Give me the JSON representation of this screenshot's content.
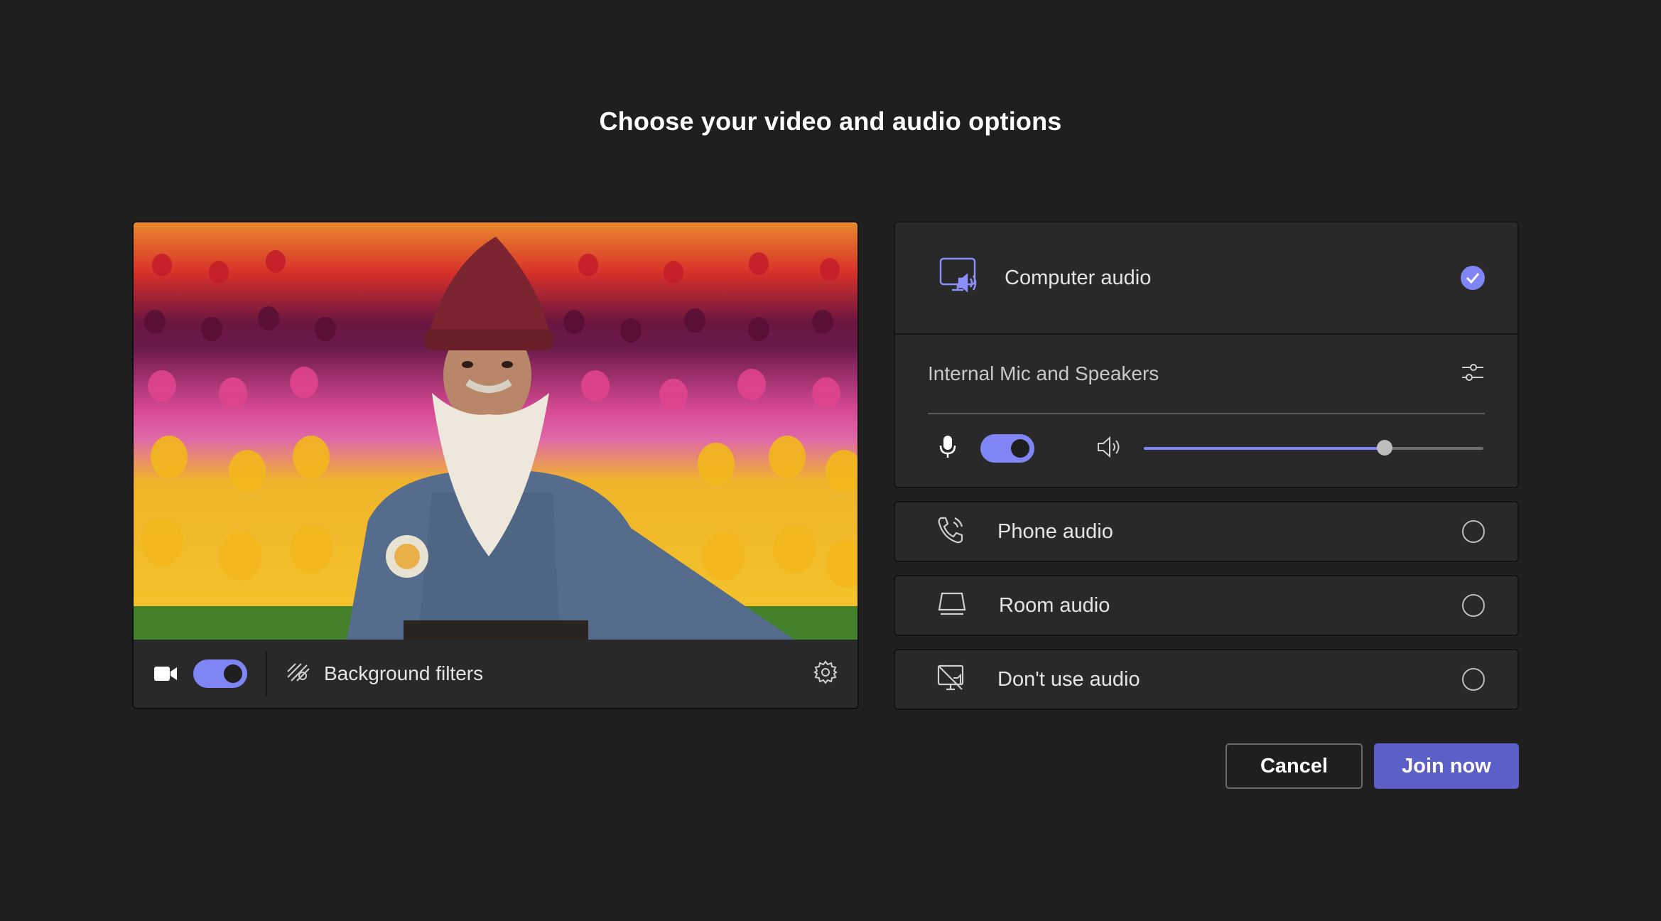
{
  "page": {
    "title": "Choose your video and audio options"
  },
  "video": {
    "camera_on": true,
    "background_filters_label": "Background filters",
    "icons": {
      "camera": "video-camera-icon",
      "filters": "background-filters-icon",
      "settings": "gear-icon"
    }
  },
  "audio": {
    "computer": {
      "label": "Computer audio",
      "selected": true,
      "device": "Internal Mic and Speakers",
      "mic_on": true,
      "speaker_volume": 0.71,
      "icons": {
        "option": "computer-audio-icon",
        "device_settings": "sliders-icon",
        "mic": "microphone-icon",
        "speaker": "speaker-icon",
        "selected": "check-icon"
      }
    },
    "phone": {
      "label": "Phone audio",
      "selected": false,
      "icon": "phone-audio-icon"
    },
    "room": {
      "label": "Room audio",
      "selected": false,
      "icon": "room-audio-icon"
    },
    "none": {
      "label": "Don't use audio",
      "selected": false,
      "icon": "no-audio-icon"
    }
  },
  "actions": {
    "cancel": "Cancel",
    "join": "Join now"
  },
  "colors": {
    "background": "#1f1f1f",
    "panel": "#292929",
    "accent": "#7f85f5",
    "primary_button": "#5b5fc7"
  }
}
